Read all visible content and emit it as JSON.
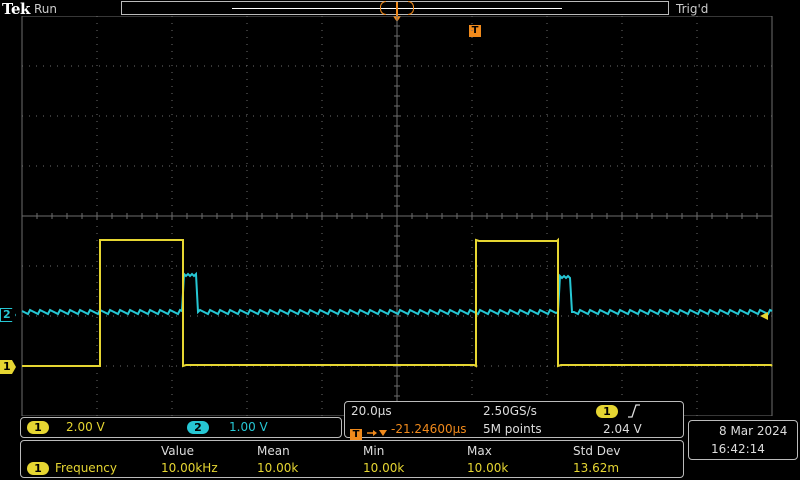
{
  "header": {
    "brand": "Tek",
    "run_state": "Run",
    "trigger_state": "Trig'd"
  },
  "markers": {
    "trigger_marker": "T",
    "ch2_marker": "2",
    "ch1_marker": "1"
  },
  "channels": {
    "ch1": {
      "label": "1",
      "scale": "2.00 V",
      "color": "#e6d632"
    },
    "ch2": {
      "label": "2",
      "scale": "1.00 V",
      "color": "#26c7d4"
    }
  },
  "timebase": {
    "horizontal_scale": "20.0µs",
    "sample_rate": "2.50GS/s",
    "trigger_delay": "-21.24600µs",
    "record_length": "5M points",
    "trigger_source": "1",
    "trigger_slope_icon": "rising-edge-icon",
    "trigger_level": "2.04 V"
  },
  "datetime": {
    "date": "8 Mar  2024",
    "time": "16:42:14"
  },
  "measurements": {
    "headers": [
      "Value",
      "Mean",
      "Min",
      "Max",
      "Std Dev"
    ],
    "rows": [
      {
        "channel": "1",
        "name": "Frequency",
        "value": "10.00kHz",
        "mean": "10.00k",
        "min": "10.00k",
        "max": "10.00k",
        "std_dev": "13.62m"
      }
    ]
  },
  "colors": {
    "grid": "#808080",
    "trigger": "#f08a1c"
  }
}
